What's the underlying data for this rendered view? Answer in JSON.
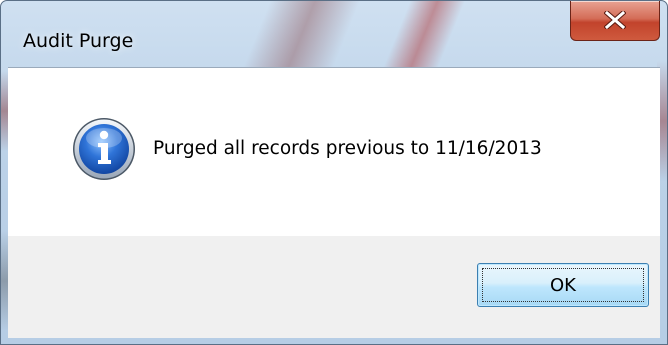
{
  "window": {
    "title": "Audit Purge",
    "close_tooltip_icon": "close-icon"
  },
  "dialog": {
    "icon": "info-icon",
    "message": "Purged all records previous to 11/16/2013"
  },
  "buttons": {
    "ok_label": "OK"
  },
  "colors": {
    "close_button": "#c8452d",
    "info_icon": "#1d5fbf",
    "ok_border": "#3c7fb1",
    "button_bar": "#f0f0f0"
  }
}
